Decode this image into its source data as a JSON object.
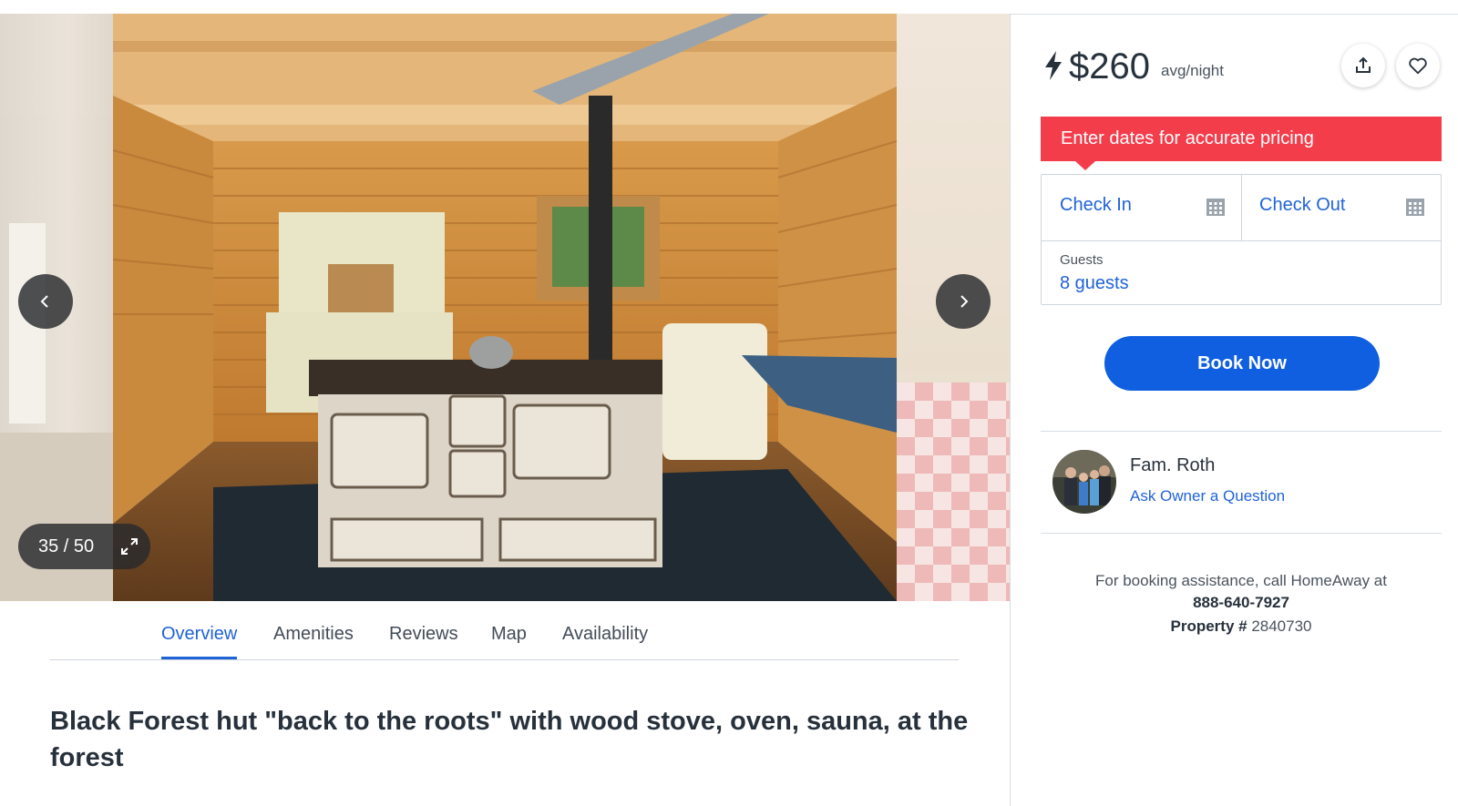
{
  "gallery": {
    "counter": "35 / 50",
    "prev_icon": "chevron-left-icon",
    "next_icon": "chevron-right-icon",
    "expand_icon": "expand-icon"
  },
  "tabs": [
    {
      "label": "Overview",
      "active": true
    },
    {
      "label": "Amenities",
      "active": false
    },
    {
      "label": "Reviews",
      "active": false
    },
    {
      "label": "Map",
      "active": false
    },
    {
      "label": "Availability",
      "active": false
    }
  ],
  "listing": {
    "title": "Black Forest hut \"back to the roots\" with wood stove, oven, sauna, at the forest"
  },
  "pricing": {
    "amount": "$260",
    "unit": "avg/night",
    "alert": "Enter dates for accurate pricing"
  },
  "booking": {
    "check_in": "Check In",
    "check_out": "Check Out",
    "guests_label": "Guests",
    "guests_value": "8 guests",
    "book_button": "Book Now"
  },
  "owner": {
    "name": "Fam. Roth",
    "ask_link": "Ask Owner a Question"
  },
  "assistance": {
    "text": "For booking assistance, call HomeAway at",
    "phone": "888-640-7927",
    "property_label": "Property #",
    "property_number": "2840730"
  },
  "colors": {
    "accent": "#1f63d8",
    "button": "#0f5fe0",
    "alert": "#f43d4b"
  }
}
